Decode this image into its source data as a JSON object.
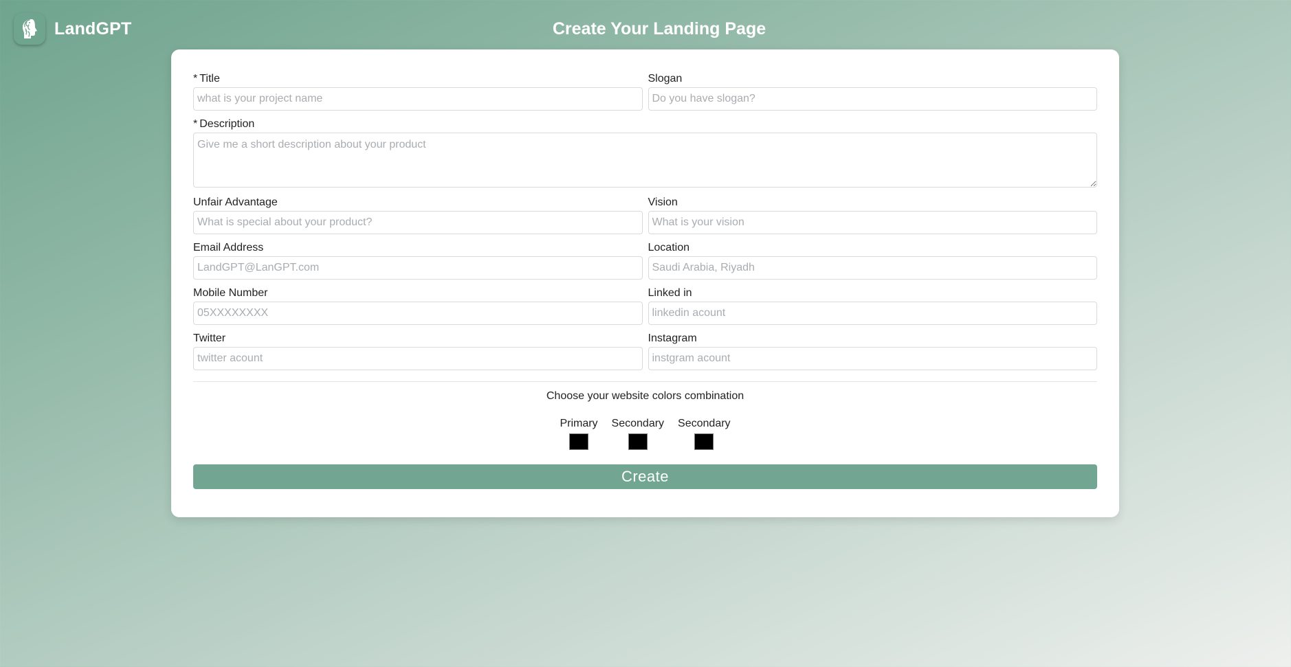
{
  "header": {
    "app_name": "LandGPT",
    "page_title": "Create Your Landing Page",
    "logo_icon": "brain-head-icon"
  },
  "form": {
    "required_marker": "*",
    "title": {
      "label": "Title",
      "placeholder": "what is your project name",
      "required": true
    },
    "slogan": {
      "label": "Slogan",
      "placeholder": "Do you have slogan?"
    },
    "description": {
      "label": "Description",
      "placeholder": "Give me a short description about your product",
      "required": true
    },
    "unfair_advantage": {
      "label": "Unfair Advantage",
      "placeholder": "What is special about your product?"
    },
    "vision": {
      "label": "Vision",
      "placeholder": "What is your vision"
    },
    "email": {
      "label": "Email Address",
      "placeholder": "LandGPT@LanGPT.com"
    },
    "location": {
      "label": "Location",
      "placeholder": "Saudi Arabia, Riyadh"
    },
    "mobile": {
      "label": "Mobile Number",
      "placeholder": "05XXXXXXXX"
    },
    "linkedin": {
      "label": "Linked in",
      "placeholder": "linkedin acount"
    },
    "twitter": {
      "label": "Twitter",
      "placeholder": "twitter acount"
    },
    "instagram": {
      "label": "Instagram",
      "placeholder": "instgram acount"
    }
  },
  "colors": {
    "title": "Choose your website colors combination",
    "pickers": [
      {
        "label": "Primary",
        "value": "#000000"
      },
      {
        "label": "Secondary",
        "value": "#000000"
      },
      {
        "label": "Secondary",
        "value": "#000000"
      }
    ]
  },
  "actions": {
    "create_label": "Create"
  },
  "theme": {
    "accent": "#72a592",
    "background_start": "#6fa48e",
    "background_end": "#eef0ee"
  }
}
